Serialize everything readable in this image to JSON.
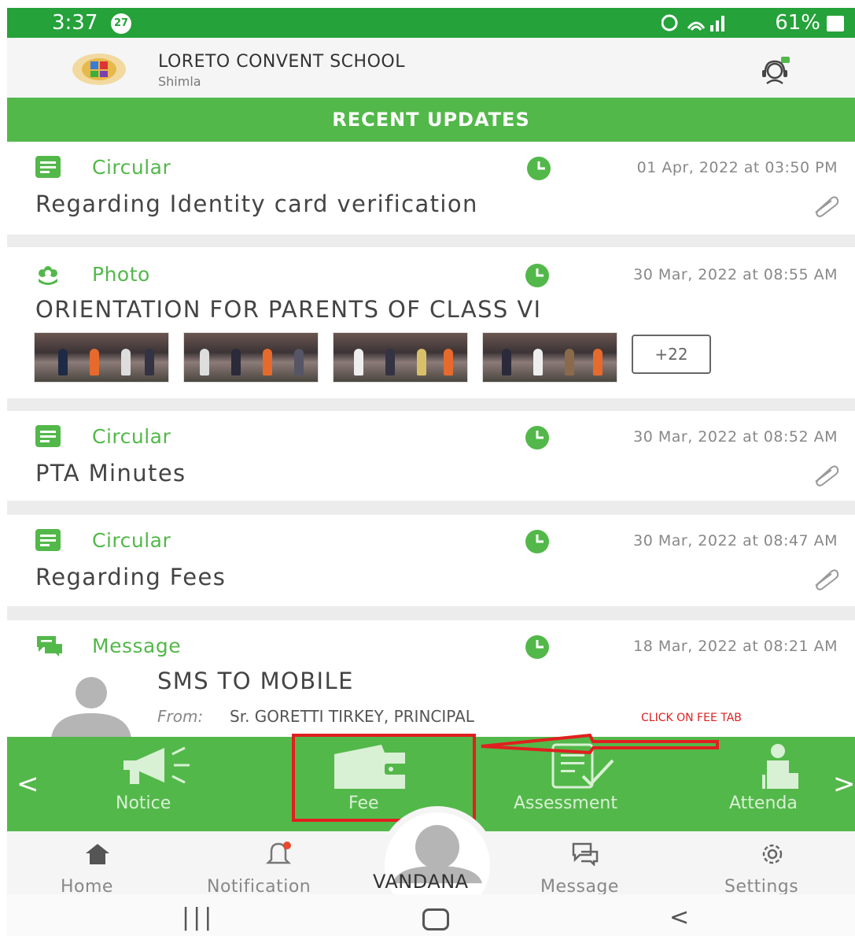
{
  "status_bar": {
    "time": "3:37",
    "badge": "27",
    "battery": "61%"
  },
  "header": {
    "school_name": "LORETO CONVENT SCHOOL",
    "city": "Shimla"
  },
  "section": {
    "title": "RECENT UPDATES"
  },
  "feed": [
    {
      "category": "Circular",
      "icon": "document-icon",
      "date": "01 Apr, 2022 at 03:50 PM",
      "title": "Regarding Identity card verification",
      "attachment": true
    },
    {
      "category": "Photo",
      "icon": "flower-icon",
      "date": "30 Mar, 2022 at 08:55 AM",
      "title": "ORIENTATION FOR PARENTS OF CLASS VI",
      "more_photos": "+22"
    },
    {
      "category": "Circular",
      "icon": "document-icon",
      "date": "30 Mar, 2022 at 08:52 AM",
      "title": "PTA Minutes",
      "attachment": true
    },
    {
      "category": "Circular",
      "icon": "document-icon",
      "date": "30 Mar, 2022 at 08:47 AM",
      "title": "Regarding Fees",
      "attachment": true
    },
    {
      "category": "Message",
      "icon": "chat-bubbles-icon",
      "date": "18 Mar, 2022 at 08:21 AM",
      "title": "SMS TO MOBILE",
      "from_label": "From:",
      "from": "Sr. GORETTI TIRKEY, PRINCIPAL"
    }
  ],
  "annotation": "CLICK ON FEE TAB",
  "quick_tabs": [
    {
      "label": "Notice",
      "icon": "megaphone-icon"
    },
    {
      "label": "Fee",
      "icon": "wallet-icon"
    },
    {
      "label": "Assessment",
      "icon": "checklist-icon"
    },
    {
      "label": "Attenda",
      "icon": "attendance-icon"
    }
  ],
  "bottom_nav": [
    {
      "label": "Home",
      "icon": "home-icon"
    },
    {
      "label": "Notification",
      "icon": "bell-icon"
    },
    {
      "label": "VANDANA",
      "icon": "avatar-icon"
    },
    {
      "label": "Message",
      "icon": "message-icon"
    },
    {
      "label": "Settings",
      "icon": "gear-icon"
    }
  ],
  "colors": {
    "status_green": "#25a23a",
    "accent_green": "#53b84a",
    "highlight_red": "#e02020"
  }
}
